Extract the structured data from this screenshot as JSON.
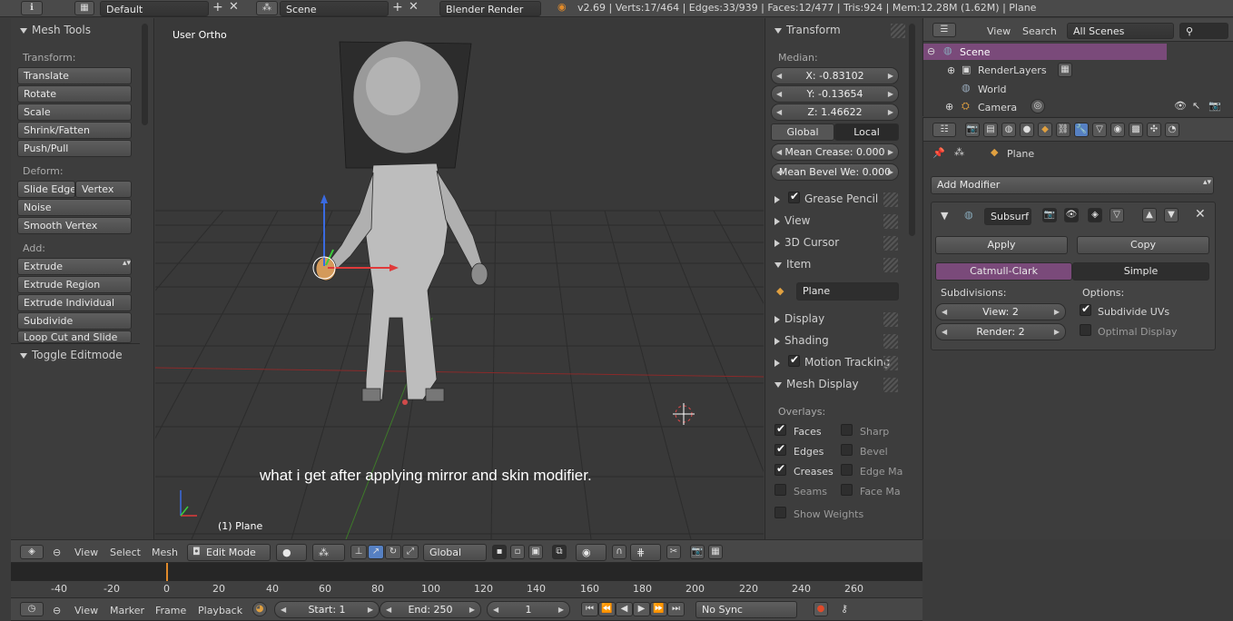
{
  "topbar": {
    "layout": "Default",
    "scene": "Scene",
    "renderer": "Blender Render",
    "stats": "v2.69 | Verts:17/464 | Edges:33/939 | Faces:12/477 | Tris:924 | Mem:12.28M (1.62M) | Plane"
  },
  "tools": {
    "title": "Mesh Tools",
    "transform_label": "Transform:",
    "transform": [
      "Translate",
      "Rotate",
      "Scale",
      "Shrink/Fatten",
      "Push/Pull"
    ],
    "deform_label": "Deform:",
    "slide_edge": "Slide Edge",
    "vertex": "Vertex",
    "noise": "Noise",
    "smooth_vertex": "Smooth Vertex",
    "add_label": "Add:",
    "extrude": "Extrude",
    "add": [
      "Extrude Region",
      "Extrude Individual",
      "Subdivide",
      "Loop Cut and Slide"
    ],
    "toggle_editmode": "Toggle Editmode"
  },
  "viewport": {
    "view_label": "User Ortho",
    "object_label": "(1) Plane",
    "caption": "what i get after applying mirror and skin modifier."
  },
  "npanel": {
    "transform_title": "Transform",
    "median": "Median:",
    "x": "X: -0.83102",
    "y": "Y: -0.13654",
    "z": "Z: 1.46622",
    "global": "Global",
    "local": "Local",
    "mean_crease": "Mean Crease: 0.000",
    "mean_bevel": "Mean Bevel We: 0.000",
    "grease_pencil": "Grease Pencil",
    "view": "View",
    "cursor": "3D Cursor",
    "item": "Item",
    "item_name": "Plane",
    "display": "Display",
    "shading": "Shading",
    "motion_tracking": "Motion Tracking",
    "mesh_display": "Mesh Display",
    "overlays": "Overlays:",
    "faces": "Faces",
    "sharp": "Sharp",
    "edges": "Edges",
    "bevel": "Bevel",
    "creases": "Creases",
    "edge_marks": "Edge Ma",
    "seams": "Seams",
    "face_marks": "Face Ma",
    "show_weights": "Show Weights"
  },
  "outliner": {
    "view": "View",
    "search": "Search",
    "scope": "All Scenes",
    "items": [
      "Scene",
      "RenderLayers",
      "World",
      "Camera"
    ]
  },
  "properties": {
    "object": "Plane",
    "add_modifier": "Add Modifier",
    "modifier_name": "Subsurf",
    "apply": "Apply",
    "copy": "Copy",
    "catmull": "Catmull-Clark",
    "simple": "Simple",
    "subdivisions": "Subdivisions:",
    "options": "Options:",
    "view_levels": "View: 2",
    "render_levels": "Render: 2",
    "subdivide_uvs": "Subdivide UVs",
    "optimal_display": "Optimal Display"
  },
  "view3d_header": {
    "view": "View",
    "select": "Select",
    "mesh": "Mesh",
    "mode": "Edit Mode",
    "orientation": "Global"
  },
  "timeline": {
    "ticks": [
      "-40",
      "-20",
      "0",
      "20",
      "40",
      "60",
      "80",
      "100",
      "120",
      "140",
      "160",
      "180",
      "200",
      "220",
      "240",
      "260"
    ],
    "view": "View",
    "marker": "Marker",
    "frame": "Frame",
    "playback": "Playback",
    "start": "Start: 1",
    "end": "End: 250",
    "current": "1",
    "sync": "No Sync"
  },
  "colors": {
    "accent_purple": "#7a4a7a",
    "selected_blue": "#5680c2",
    "bg_viewport": "#393939",
    "current_frame": "#e08a2a"
  }
}
